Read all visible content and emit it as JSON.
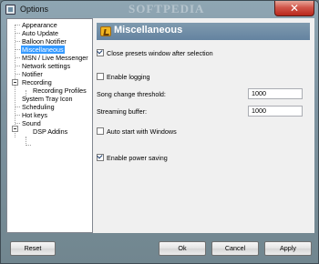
{
  "window": {
    "title": "Options",
    "watermark": "SOFTPEDIA",
    "close_glyph": "✕"
  },
  "tree": {
    "items": [
      {
        "label": "Appearance"
      },
      {
        "label": "Auto Update"
      },
      {
        "label": "Balloon Notifier"
      },
      {
        "label": "Miscellaneous",
        "selected": true
      },
      {
        "label": "MSN / Live Messenger"
      },
      {
        "label": "Network settings"
      },
      {
        "label": "Notifier"
      },
      {
        "label": "Recording"
      },
      {
        "label": "Recording Profiles"
      },
      {
        "label": "System Tray Icon"
      },
      {
        "label": "Scheduling"
      },
      {
        "label": "Hot keys"
      },
      {
        "label": "Sound"
      },
      {
        "label": "DSP Addins"
      }
    ]
  },
  "panel": {
    "title": "Miscellaneous",
    "options": {
      "close_presets": {
        "label": "Close presets window after selection",
        "checked": true
      },
      "enable_logging": {
        "label": "Enable logging",
        "checked": false
      },
      "song_change_threshold": {
        "label": "Song change threshold:",
        "value": "1000"
      },
      "streaming_buffer": {
        "label": "Streaming buffer:",
        "value": "1000"
      },
      "auto_start": {
        "label": "Auto start with Windows",
        "checked": false
      },
      "power_saving": {
        "label": "Enable power saving",
        "checked": true
      }
    }
  },
  "buttons": {
    "reset": "Reset",
    "ok": "Ok",
    "cancel": "Cancel",
    "apply": "Apply"
  }
}
